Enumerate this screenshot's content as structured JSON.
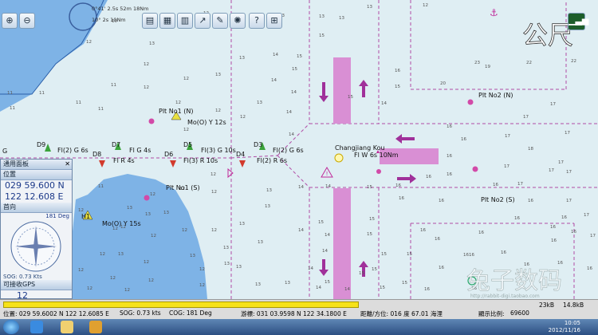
{
  "toolbar": {
    "overlay_lines": [
      "0°41' 2.5s 52m 18Nm",
      "10° 2s 10Nm"
    ]
  },
  "watermark": {
    "top_right": "公尺",
    "bottom_right": "兔子数码",
    "url": "http://rabbit-digi.taobao.com"
  },
  "map_labels": {
    "plt_no1_n": "Plt No1 (N)",
    "mo_y12": "Mo(O) Y 12s",
    "plt_no2_n": "Plt No2 (N)",
    "changjiang": "Changjiang Kou",
    "fl_w6": "Fl W 6s 10Nm",
    "d9": "D9",
    "fl2g6_left": "Fl(2) G 6s",
    "d8": "D8",
    "fl_r4": "Fl R 4s",
    "d7": "D7",
    "fl_g4": "Fl G 4s",
    "d6": "D6",
    "fl3r10": "Fl(3) R 10s",
    "d5": "D5",
    "fl3g10": "Fl(3) G 10s",
    "d4": "D4",
    "fl2r6": "Fl(2) R 6s",
    "d3": "D3",
    "fl2g6_right": "Fl(2) G 6s",
    "plt_no1_s": "Plt No1 (S)",
    "plt_no2_s": "Plt No2 (S)",
    "h1": "H1",
    "mo_y15": "Mo(O) Y 15s",
    "g_left": "G"
  },
  "panel": {
    "title": "通用面板",
    "position_header": "位置",
    "lat": "029 59.600 N",
    "lon": "122 12.608 E",
    "heading_header": "首向",
    "heading_deg": "181 Deg",
    "sog": "SOG: 0.73 Kts",
    "gps_header": "可接收GPS",
    "gps_count": "12"
  },
  "status": {
    "position": "位置: 029 59.6002 N   122 12.6085 E",
    "sog": "SOG:  0.73 kts",
    "cog": "COG:   181 Deg",
    "cursor": "游標: 031 03.9598 N 122 34.1800 E",
    "bearing": "距離/方位: 016 度    67.01 海浬",
    "scale_label": "顯示比例:",
    "scale_value": "69600",
    "tray_a": "23kB",
    "tray_b": "14.8kB"
  },
  "taskbar": {
    "date": "2012/11/16",
    "time": "10:05"
  },
  "soundings": [
    [
      "10",
      140,
      28
    ],
    [
      "11",
      178,
      27
    ],
    [
      "11",
      225,
      27
    ],
    [
      "12",
      255,
      18
    ],
    [
      "11",
      300,
      22
    ],
    [
      "13",
      350,
      21
    ],
    [
      "13",
      400,
      22
    ],
    [
      "13",
      425,
      24
    ],
    [
      "13",
      460,
      10
    ],
    [
      "12",
      530,
      8
    ],
    [
      "23",
      595,
      80
    ],
    [
      "22",
      660,
      80
    ],
    [
      "22",
      716,
      78
    ],
    [
      "20",
      552,
      106
    ],
    [
      "19",
      608,
      85
    ],
    [
      "15",
      400,
      46
    ],
    [
      "15",
      372,
      72
    ],
    [
      "14",
      342,
      70
    ],
    [
      "15",
      366,
      88
    ],
    [
      "14",
      365,
      117
    ],
    [
      "15",
      436,
      123
    ],
    [
      "15",
      495,
      110
    ],
    [
      "16",
      495,
      90
    ],
    [
      "14",
      340,
      102
    ],
    [
      "13",
      300,
      74
    ],
    [
      "13",
      270,
      95
    ],
    [
      "12",
      230,
      100
    ],
    [
      "12",
      180,
      82
    ],
    [
      "13",
      187,
      56
    ],
    [
      "12",
      108,
      54
    ],
    [
      "11",
      139,
      108
    ],
    [
      "11",
      123,
      138
    ],
    [
      "11",
      95,
      130
    ],
    [
      "11",
      49,
      118
    ],
    [
      "11",
      12,
      137
    ],
    [
      "11",
      9,
      118
    ],
    [
      "12",
      180,
      111
    ],
    [
      "12",
      220,
      130
    ],
    [
      "12",
      230,
      164
    ],
    [
      "12",
      270,
      140
    ],
    [
      "12",
      301,
      148
    ],
    [
      "13",
      322,
      130
    ],
    [
      "14",
      359,
      142
    ],
    [
      "14",
      362,
      170
    ],
    [
      "14",
      478,
      131
    ],
    [
      "16",
      496,
      234
    ],
    [
      "15",
      460,
      236
    ],
    [
      "15",
      463,
      276
    ],
    [
      "15",
      460,
      295
    ],
    [
      "16",
      500,
      250
    ],
    [
      "16",
      550,
      253
    ],
    [
      "16",
      578,
      176
    ],
    [
      "16",
      560,
      160
    ],
    [
      "17",
      633,
      172
    ],
    [
      "18",
      662,
      188
    ],
    [
      "17",
      656,
      148
    ],
    [
      "17",
      690,
      132
    ],
    [
      "17",
      708,
      168
    ],
    [
      "17",
      710,
      253
    ],
    [
      "16",
      662,
      253
    ],
    [
      "16",
      645,
      275
    ],
    [
      "16",
      600,
      293
    ],
    [
      "16",
      588,
      321
    ],
    [
      "16",
      545,
      301
    ],
    [
      "15",
      510,
      320
    ],
    [
      "15",
      478,
      320
    ],
    [
      "15",
      450,
      344
    ],
    [
      "15",
      504,
      356
    ],
    [
      "15",
      476,
      362
    ],
    [
      "14",
      432,
      364
    ],
    [
      "14",
      396,
      362
    ],
    [
      "14",
      386,
      338
    ],
    [
      "14",
      374,
      290
    ],
    [
      "14",
      374,
      236
    ],
    [
      "14",
      408,
      235
    ],
    [
      "13",
      334,
      240
    ],
    [
      "13",
      332,
      260
    ],
    [
      "13",
      300,
      282
    ],
    [
      "13",
      323,
      305
    ],
    [
      "13",
      281,
      332
    ],
    [
      "13",
      280,
      312
    ],
    [
      "13",
      238,
      322
    ],
    [
      "13",
      296,
      336
    ],
    [
      "13",
      320,
      358
    ],
    [
      "13",
      357,
      356
    ],
    [
      "12",
      265,
      290
    ],
    [
      "12",
      265,
      242
    ],
    [
      "12",
      264,
      220
    ],
    [
      "12",
      225,
      238
    ],
    [
      "12",
      188,
      245
    ],
    [
      "12",
      189,
      297
    ],
    [
      "12",
      180,
      330
    ],
    [
      "12",
      186,
      353
    ],
    [
      "12",
      138,
      350
    ],
    [
      "12",
      125,
      320
    ],
    [
      "12",
      141,
      288
    ],
    [
      "12",
      151,
      286
    ],
    [
      "13",
      159,
      262
    ],
    [
      "11",
      123,
      235
    ],
    [
      "13",
      148,
      320
    ],
    [
      "13",
      182,
      270
    ],
    [
      "13",
      205,
      268
    ],
    [
      "12",
      228,
      290
    ],
    [
      "12",
      250,
      339
    ],
    [
      "12",
      250,
      359
    ],
    [
      "12",
      156,
      365
    ],
    [
      "12",
      109,
      363
    ],
    [
      "12",
      98,
      265
    ],
    [
      "12",
      98,
      340
    ],
    [
      "14",
      407,
      296
    ],
    [
      "14",
      404,
      316
    ],
    [
      "15",
      407,
      355
    ],
    [
      "15",
      399,
      280
    ],
    [
      "15",
      466,
      339
    ],
    [
      "16",
      550,
      337
    ],
    [
      "16",
      581,
      321
    ],
    [
      "16",
      628,
      318
    ],
    [
      "16",
      657,
      333
    ],
    [
      "16",
      699,
      331
    ],
    [
      "16",
      690,
      286
    ],
    [
      "16",
      691,
      303
    ],
    [
      "16",
      704,
      274
    ],
    [
      "16",
      716,
      292
    ],
    [
      "17",
      732,
      271
    ],
    [
      "17",
      740,
      297
    ],
    [
      "16",
      736,
      338
    ],
    [
      "16",
      591,
      363
    ],
    [
      "16",
      532,
      364
    ],
    [
      "16",
      560,
      220
    ],
    [
      "16",
      560,
      197
    ],
    [
      "16",
      534,
      223
    ],
    [
      "16",
      527,
      290
    ],
    [
      "17",
      632,
      210
    ],
    [
      "17",
      649,
      232
    ],
    [
      "17",
      688,
      215
    ],
    [
      "17",
      710,
      217
    ],
    [
      "17",
      700,
      205
    ],
    [
      "16",
      618,
      233
    ]
  ]
}
